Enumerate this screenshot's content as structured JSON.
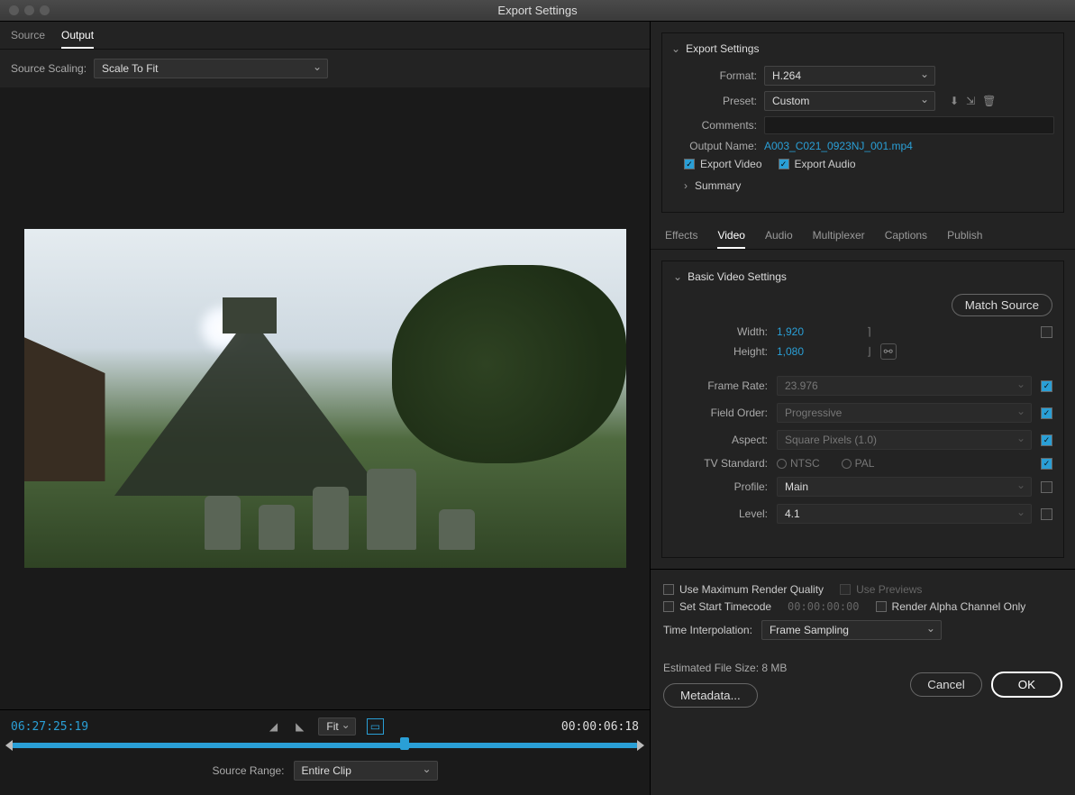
{
  "window": {
    "title": "Export Settings"
  },
  "left": {
    "tabs": {
      "source": "Source",
      "output": "Output"
    },
    "scaling_label": "Source Scaling:",
    "scaling_value": "Scale To Fit",
    "timecode_in": "06:27:25:19",
    "timecode_out": "00:00:06:18",
    "zoom": "Fit",
    "source_range_label": "Source Range:",
    "source_range_value": "Entire Clip"
  },
  "export": {
    "section_title": "Export Settings",
    "format_label": "Format:",
    "format_value": "H.264",
    "preset_label": "Preset:",
    "preset_value": "Custom",
    "comments_label": "Comments:",
    "comments_value": "",
    "output_name_label": "Output Name:",
    "output_name_value": "A003_C021_0923NJ_001.mp4",
    "export_video_label": "Export Video",
    "export_audio_label": "Export Audio",
    "summary_label": "Summary"
  },
  "subtabs": {
    "effects": "Effects",
    "video": "Video",
    "audio": "Audio",
    "multiplexer": "Multiplexer",
    "captions": "Captions",
    "publish": "Publish"
  },
  "video": {
    "section_title": "Basic Video Settings",
    "match_source": "Match Source",
    "width_label": "Width:",
    "width_value": "1,920",
    "height_label": "Height:",
    "height_value": "1,080",
    "frame_rate_label": "Frame Rate:",
    "frame_rate_value": "23.976",
    "field_order_label": "Field Order:",
    "field_order_value": "Progressive",
    "aspect_label": "Aspect:",
    "aspect_value": "Square Pixels (1.0)",
    "tv_standard_label": "TV Standard:",
    "tv_ntsc": "NTSC",
    "tv_pal": "PAL",
    "profile_label": "Profile:",
    "profile_value": "Main",
    "level_label": "Level:",
    "level_value": "4.1"
  },
  "bottom": {
    "max_quality": "Use Maximum Render Quality",
    "use_previews": "Use Previews",
    "start_tc": "Set Start Timecode",
    "start_tc_value": "00:00:00:00",
    "alpha_only": "Render Alpha Channel Only",
    "ti_label": "Time Interpolation:",
    "ti_value": "Frame Sampling",
    "est_label": "Estimated File Size:",
    "est_value": "8 MB",
    "metadata": "Metadata...",
    "cancel": "Cancel",
    "ok": "OK"
  }
}
